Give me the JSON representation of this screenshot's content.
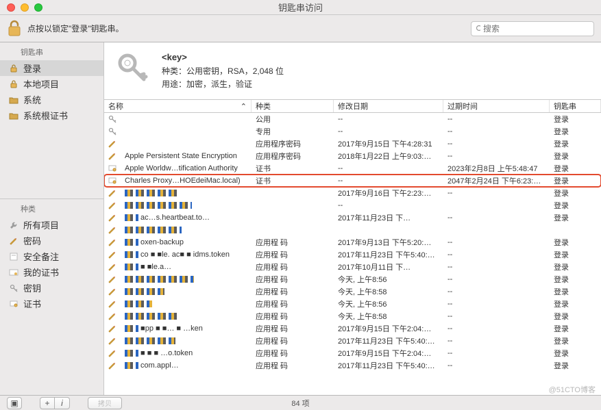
{
  "window": {
    "title": "钥匙串访问",
    "lock_text": "点按以锁定\"登录\"钥匙串。"
  },
  "search": {
    "placeholder": "搜索"
  },
  "sidebar": {
    "sec1_title": "钥匙串",
    "items1": [
      {
        "label": "登录"
      },
      {
        "label": "本地项目"
      },
      {
        "label": "系统"
      },
      {
        "label": "系统根证书"
      }
    ],
    "sec2_title": "种类",
    "items2": [
      {
        "label": "所有项目"
      },
      {
        "label": "密码"
      },
      {
        "label": "安全备注"
      },
      {
        "label": "我的证书"
      },
      {
        "label": "密钥"
      },
      {
        "label": "证书"
      }
    ]
  },
  "info": {
    "title": "<key>",
    "kind_label": "种类：",
    "kind_value": "公用密钥，RSA，2,048 位",
    "use_label": "用途：",
    "use_value": "加密，派生，验证"
  },
  "columns": {
    "name": "名称",
    "kind": "种类",
    "modified": "修改日期",
    "expires": "过期时间",
    "keychain": "钥匙串"
  },
  "rows": [
    {
      "name": "",
      "kind": "公用",
      "mod": "--",
      "exp": "--",
      "kc": "登录",
      "icon": "key"
    },
    {
      "name": "",
      "kind": "专用",
      "mod": "--",
      "exp": "--",
      "kc": "登录",
      "icon": "key"
    },
    {
      "name": "",
      "kind": "应用程序密码",
      "mod": "2017年9月15日 下午4:28:31",
      "exp": "--",
      "kc": "登录",
      "icon": "note"
    },
    {
      "name": "Apple Persistent State Encryption",
      "kind": "应用程序密码",
      "mod": "2018年1月22日 上午9:03:…",
      "exp": "--",
      "kc": "登录",
      "icon": "note"
    },
    {
      "name": "Apple Worldw…tification Authority",
      "kind": "证书",
      "mod": "--",
      "exp": "2023年2月8日 上午5:48:47",
      "kc": "登录",
      "icon": "cert"
    },
    {
      "name": "Charles Proxy…HOEdeiMac.local)",
      "kind": "证书",
      "mod": "--",
      "exp": "2047年2月24日 下午6:23:…",
      "kc": "登录",
      "icon": "cert",
      "highlight": true
    },
    {
      "name": "",
      "kind": "",
      "mod": "2017年9月16日 下午2:23:…",
      "exp": "--",
      "kc": "登录",
      "icon": "note",
      "pix": true
    },
    {
      "name": "",
      "kind": "",
      "mod": "--",
      "exp": "",
      "kc": "登录",
      "icon": "note",
      "pix": true
    },
    {
      "name": "ac…s.heartbeat.to…",
      "kind": "",
      "mod": "2017年11月23日 下…",
      "exp": "--",
      "kc": "登录",
      "icon": "note",
      "pix": true
    },
    {
      "name": "",
      "kind": "",
      "mod": "",
      "exp": "",
      "kc": "",
      "icon": "note",
      "pix": true
    },
    {
      "name": "oxen-backup",
      "kind": "应用程  码",
      "mod": "2017年9月13日 下午5:20:…",
      "exp": "--",
      "kc": "登录",
      "icon": "note",
      "pix": true
    },
    {
      "name": "co ■ ■le. ac■ ■ idms.token",
      "kind": "应用程  码",
      "mod": "2017年11月23日 下午5:40:…",
      "exp": "--",
      "kc": "登录",
      "icon": "note",
      "pix": true
    },
    {
      "name": "■ ■le.a…",
      "kind": "应用程  码",
      "mod": "2017年10月11日 下…",
      "exp": "--",
      "kc": "登录",
      "icon": "note",
      "pix": true
    },
    {
      "name": "",
      "kind": "应用程  码",
      "mod": "今天, 上午8:56",
      "exp": "--",
      "kc": "登录",
      "icon": "note",
      "pix": true
    },
    {
      "name": "",
      "kind": "应用程  码",
      "mod": "今天, 上午8:58",
      "exp": "--",
      "kc": "登录",
      "icon": "note",
      "pix": true
    },
    {
      "name": "",
      "kind": "应用程  码",
      "mod": "今天, 上午8:56",
      "exp": "--",
      "kc": "登录",
      "icon": "note",
      "pix": true
    },
    {
      "name": "",
      "kind": "应用程  码",
      "mod": "今天, 上午8:58",
      "exp": "--",
      "kc": "登录",
      "icon": "note",
      "pix": true
    },
    {
      "name": "■pp  ■  ■…  ■ …ken",
      "kind": "应用程  码",
      "mod": "2017年9月15日 下午2:04:…",
      "exp": "--",
      "kc": "登录",
      "icon": "note",
      "pix": true
    },
    {
      "name": "",
      "kind": "应用程  码",
      "mod": "2017年11月23日 下午5:40:…",
      "exp": "--",
      "kc": "登录",
      "icon": "note",
      "pix": true
    },
    {
      "name": "■ ■  ■  …o.token",
      "kind": "应用程  码",
      "mod": "2017年9月15日 下午2:04:…",
      "exp": "--",
      "kc": "登录",
      "icon": "note",
      "pix": true
    },
    {
      "name": "com.appl…",
      "kind": "应用程  码",
      "mod": "2017年11月23日 下午5:40:…",
      "exp": "--",
      "kc": "登录",
      "icon": "note",
      "pix": true
    }
  ],
  "footer": {
    "count": "84 项"
  },
  "watermark": "@51CTO博客"
}
